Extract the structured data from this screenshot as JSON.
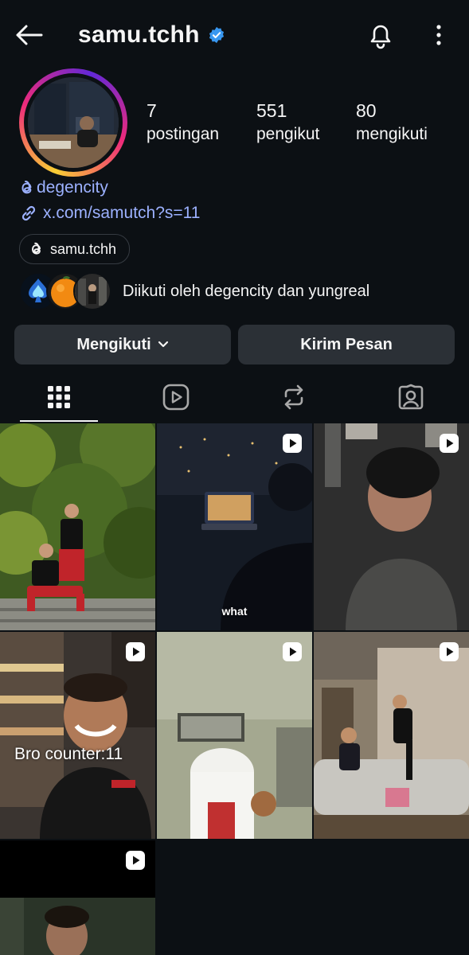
{
  "header": {
    "username": "samu.tchh",
    "verified": true
  },
  "stats": [
    {
      "value": "7",
      "label": "postingan"
    },
    {
      "value": "551",
      "label": "pengikut"
    },
    {
      "value": "80",
      "label": "mengikuti"
    }
  ],
  "bio": {
    "threads_handle": "degencity",
    "link": "x.com/samutch?s=11"
  },
  "threads_pill": "samu.tchh",
  "followed_by": "Diikuti oleh degencity dan yungreal",
  "actions": {
    "follow_label": "Mengikuti",
    "message_label": "Kirim Pesan"
  },
  "tabs": [
    "grid-icon",
    "reels-icon",
    "reposts-icon",
    "tagged-icon"
  ],
  "posts": [
    {
      "type": "photo",
      "caption": ""
    },
    {
      "type": "reel",
      "caption": "what"
    },
    {
      "type": "reel",
      "caption": ""
    },
    {
      "type": "reel",
      "caption": "Bro counter:11"
    },
    {
      "type": "reel",
      "caption": ""
    },
    {
      "type": "reel",
      "caption": ""
    },
    {
      "type": "reel",
      "caption": ""
    }
  ],
  "colors": {
    "background": "#0c1014",
    "link": "#9cb1ff",
    "button": "#2b3036",
    "verified": "#3897f0"
  }
}
